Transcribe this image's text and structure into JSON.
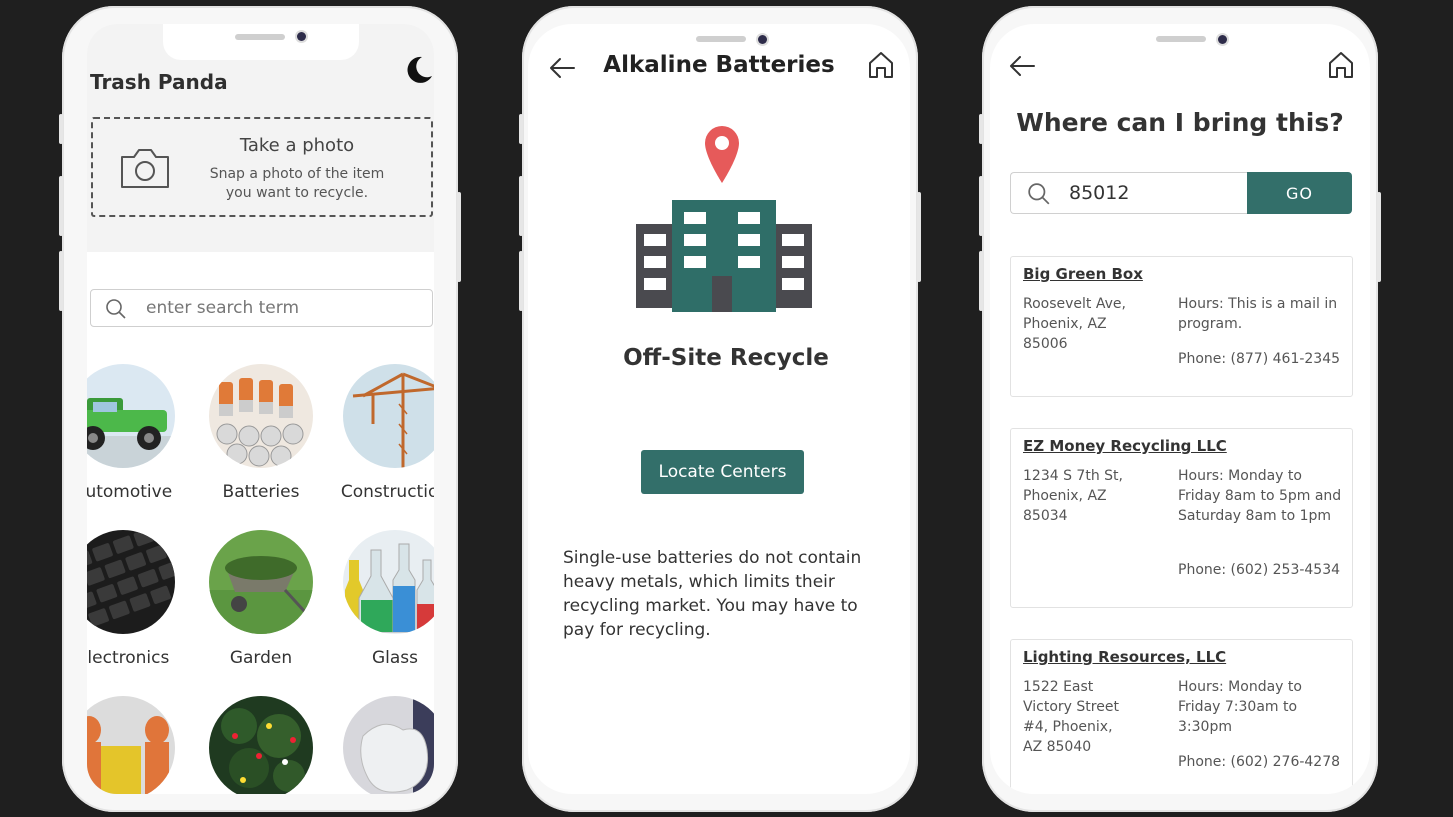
{
  "screen1": {
    "app_title": "Trash Panda",
    "photo_title": "Take a photo",
    "photo_subtitle": "Snap a photo of the item you want to recycle.",
    "search_placeholder": "enter search term",
    "categories": [
      {
        "label": "Automotive",
        "icon": "truck-photo"
      },
      {
        "label": "Batteries",
        "icon": "batteries-photo"
      },
      {
        "label": "Construction",
        "icon": "crane-photo"
      },
      {
        "label": "Electronics",
        "icon": "keyboard-photo"
      },
      {
        "label": "Garden",
        "icon": "wheelbarrow-photo"
      },
      {
        "label": "Glass",
        "icon": "bottles-photo"
      },
      {
        "label": "",
        "icon": "hazmat-photo"
      },
      {
        "label": "",
        "icon": "holiday-tree-photo"
      },
      {
        "label": "",
        "icon": "plastic-bag-photo"
      }
    ]
  },
  "screen2": {
    "title": "Alkaline Batteries",
    "method": "Off-Site Recycle",
    "button": "Locate Centers",
    "description": "Single-use batteries do not contain heavy metals, which limits their recycling market. You may have to pay for recycling."
  },
  "screen3": {
    "title": "Where can I bring this?",
    "zip_value": "85012",
    "go_label": "GO",
    "centers": [
      {
        "name": "Big Green Box",
        "address": "Roosevelt Ave, Phoenix, AZ 85006",
        "hours": "Hours: This is a mail in program.",
        "phone": "Phone: (877) 461-2345"
      },
      {
        "name": "EZ Money Recycling LLC",
        "address": "1234 S 7th St, Phoenix, AZ 85034",
        "hours": "Hours: Monday to Friday 8am to 5pm and Saturday 8am to 1pm",
        "phone": "Phone: (602) 253-4534"
      },
      {
        "name": "Lighting Resources, LLC",
        "address": "1522 East Victory Street #4, Phoenix, AZ 85040",
        "hours": "Hours: Monday to Friday 7:30am to 3:30pm",
        "phone": "Phone: (602) 276-4278"
      }
    ]
  },
  "colors": {
    "accent": "#336f6a",
    "background": "#1f1f1f",
    "pin": "#e65a5a"
  }
}
